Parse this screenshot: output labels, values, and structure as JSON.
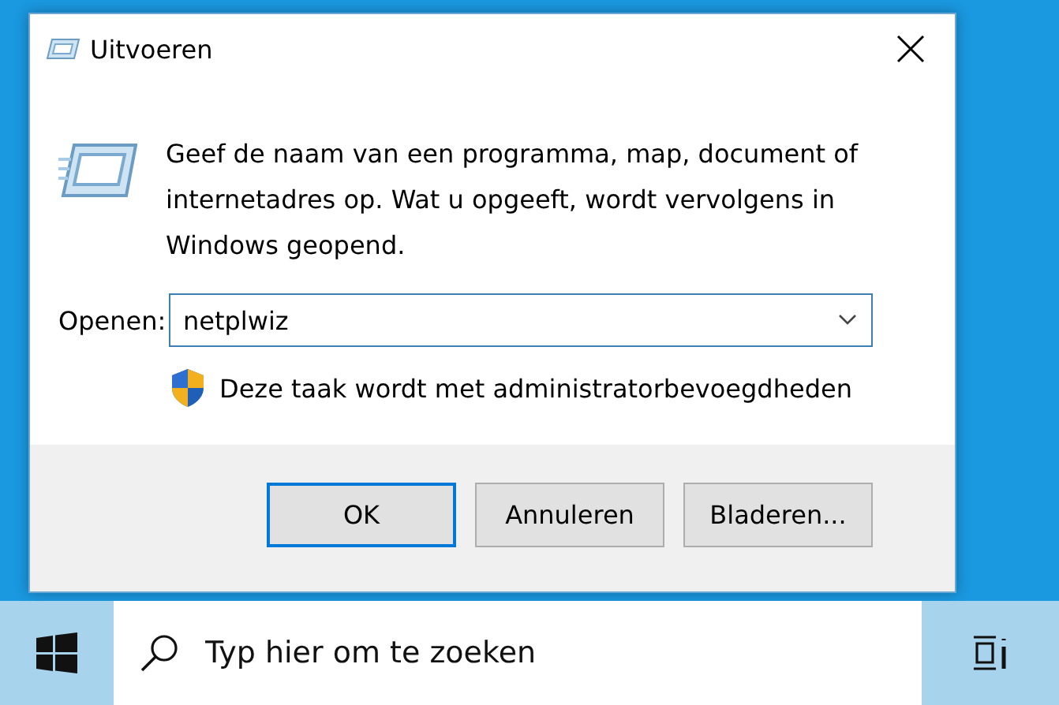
{
  "window": {
    "title": "Uitvoeren"
  },
  "description": "Geef de naam van een programma, map, document of internetadres op. Wat u opgeeft, wordt vervolgens in Windows geopend.",
  "open_field": {
    "label": "Openen:",
    "value": "netplwiz"
  },
  "admin_note": "Deze taak wordt met administratorbevoegdheden",
  "buttons": [
    {
      "label": "OK",
      "selected": true
    },
    {
      "label": "Annuleren",
      "selected": false
    },
    {
      "label": "Bladeren...",
      "selected": false
    }
  ],
  "taskbar": {
    "search": {
      "placeholder": "Typ hier om te zoeken"
    }
  }
}
